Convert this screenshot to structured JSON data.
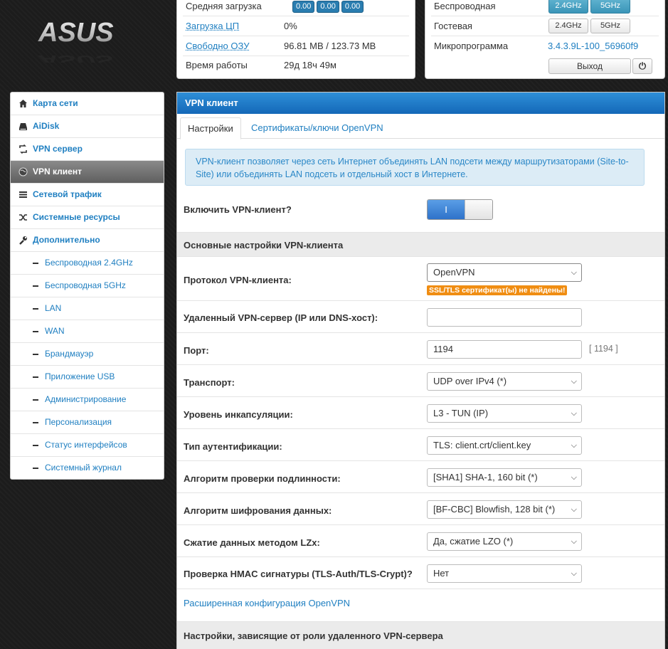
{
  "status": {
    "rows": [
      {
        "label": "Средняя загрузка",
        "values": [
          "0.00",
          "0.00",
          "0.00"
        ]
      },
      {
        "label": "Загрузка ЦП",
        "value": "0%"
      },
      {
        "label": "Свободно ОЗУ",
        "value": "96.81 MB / 123.73 MB"
      },
      {
        "label": "Время работы",
        "value": "29д 18ч 49м"
      }
    ]
  },
  "wireless": {
    "label": "Беспроводная",
    "guest_label": "Гостевая",
    "firmware_label": "Микропрограмма",
    "firmware_value": "3.4.3.9L-100_56960f9",
    "band1": "2.4GHz",
    "band2": "5GHz",
    "logout": "Выход",
    "power_glyph": "⏻"
  },
  "logo_text": "ASUS",
  "sidebar": {
    "items": [
      {
        "label": "Карта сети",
        "icon": "home-icon"
      },
      {
        "label": "AiDisk",
        "icon": "disk-icon"
      },
      {
        "label": "VPN сервер",
        "icon": "vpn-server-icon"
      },
      {
        "label": "VPN клиент",
        "icon": "globe-icon"
      },
      {
        "label": "Сетевой трафик",
        "icon": "traffic-icon"
      },
      {
        "label": "Системные ресурсы",
        "icon": "shuffle-icon"
      },
      {
        "label": "Дополнительно",
        "icon": "wrench-icon"
      },
      {
        "label": "Беспроводная 2.4GHz"
      },
      {
        "label": "Беспроводная 5GHz"
      },
      {
        "label": "LAN"
      },
      {
        "label": "WAN"
      },
      {
        "label": "Брандмауэр"
      },
      {
        "label": "Приложение USB"
      },
      {
        "label": "Администрирование"
      },
      {
        "label": "Персонализация"
      },
      {
        "label": "Статус интерфейсов"
      },
      {
        "label": "Системный журнал"
      }
    ]
  },
  "main": {
    "title": "VPN клиент",
    "tabs": [
      "Настройки",
      "Сертификаты/ключи OpenVPN"
    ],
    "info": "VPN-клиент позволяет через сеть Интернет объединять LAN подсети между маршрутизаторами (Site-to-Site) или объединять LAN подсеть и отдельный хост в Интернете.",
    "enable_label": "Включить VPN-клиент?",
    "toggle_on": "I",
    "section1": "Основные настройки VPN-клиента",
    "protocol_label": "Протокол VPN-клиента:",
    "protocol_value": "OpenVPN",
    "warning": "SSL/TLS сертификат(ы) не найдены!",
    "server_label": "Удаленный VPN-сервер (IP или DNS-хост):",
    "server_value": "",
    "port_label": "Порт:",
    "port_value": "1194",
    "port_hint": "[ 1194 ]",
    "transport_label": "Транспорт:",
    "transport_value": "UDP over IPv4 (*)",
    "encap_label": "Уровень инкапсуляции:",
    "encap_value": "L3 - TUN (IP)",
    "auth_label": "Тип аутентификации:",
    "auth_value": "TLS: client.crt/client.key",
    "hash_label": "Алгоритм проверки подлинности:",
    "hash_value": "[SHA1] SHA-1, 160 bit (*)",
    "cipher_label": "Алгоритм шифрования данных:",
    "cipher_value": "[BF-CBC] Blowfish, 128 bit (*)",
    "lzx_label": "Сжатие данных методом LZx:",
    "lzx_value": "Да, сжатие LZO (*)",
    "hmac_label": "Проверка HMAC сигнатуры (TLS-Auth/TLS-Crypt)?",
    "hmac_value": "Нет",
    "advanced_link": "Расширенная конфигурация OpenVPN",
    "section2": "Настройки, зависящие от роли удаленного VPN-сервера"
  }
}
